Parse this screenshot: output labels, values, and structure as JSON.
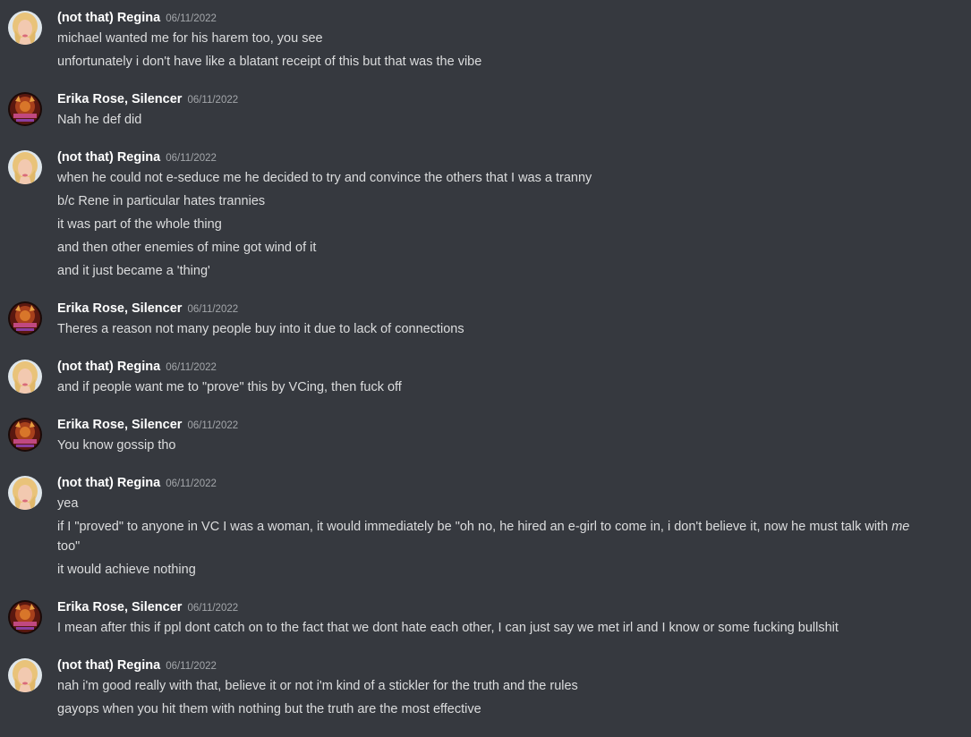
{
  "messages": [
    {
      "author": "(not that) Regina",
      "avatar": "regina-avatar",
      "date": "06/11/2022",
      "lines": [
        "michael wanted me for his harem too, you see",
        "unfortunately i don't have like a blatant receipt of this but that was the vibe"
      ]
    },
    {
      "author": "Erika Rose, Silencer",
      "avatar": "erika-avatar",
      "date": "06/11/2022",
      "lines": [
        "Nah he def did"
      ]
    },
    {
      "author": "(not that) Regina",
      "avatar": "regina-avatar",
      "date": "06/11/2022",
      "lines": [
        "when he could not e-seduce me he decided to try and convince the others that I was a tranny",
        "b/c Rene in particular hates trannies",
        "it was part of the whole thing",
        "and then other enemies of mine got wind of it",
        "and it just became a 'thing'"
      ]
    },
    {
      "author": "Erika Rose, Silencer",
      "avatar": "erika-avatar",
      "date": "06/11/2022",
      "lines": [
        "Theres a reason not many people buy into it due to lack of connections"
      ]
    },
    {
      "author": "(not that) Regina",
      "avatar": "regina-avatar",
      "date": "06/11/2022",
      "lines": [
        "and if people want me to \"prove\" this by VCing, then fuck off"
      ]
    },
    {
      "author": "Erika Rose, Silencer",
      "avatar": "erika-avatar",
      "date": "06/11/2022",
      "lines": [
        "You know gossip tho"
      ]
    },
    {
      "author": "(not that) Regina",
      "avatar": "regina-avatar",
      "date": "06/11/2022",
      "lines": [
        "yea",
        "if I \"proved\" to anyone in VC I was a woman, it would immediately be \"oh no, he hired an e-girl to come in, i don't believe it, now he must talk with ",
        "me",
        "too\"",
        "it would achieve nothing"
      ]
    },
    {
      "author": "Erika Rose, Silencer",
      "avatar": "erika-avatar",
      "date": "06/11/2022",
      "lines": [
        "I mean after this if ppl dont catch on to the fact that we dont hate each other, I can just say we met irl and I know or some fucking bullshit"
      ]
    },
    {
      "author": "(not that) Regina",
      "avatar": "regina-avatar",
      "date": "06/11/2022",
      "lines": [
        "nah i'm good really with that, believe it or not i'm kind of a stickler for the truth and the rules",
        "gayops when you hit them with nothing but the truth are the most effective"
      ]
    }
  ],
  "colors": {
    "background": "#36393f",
    "username": "#ffffff",
    "timestamp": "#a3a6aa",
    "text": "#dcddde"
  }
}
